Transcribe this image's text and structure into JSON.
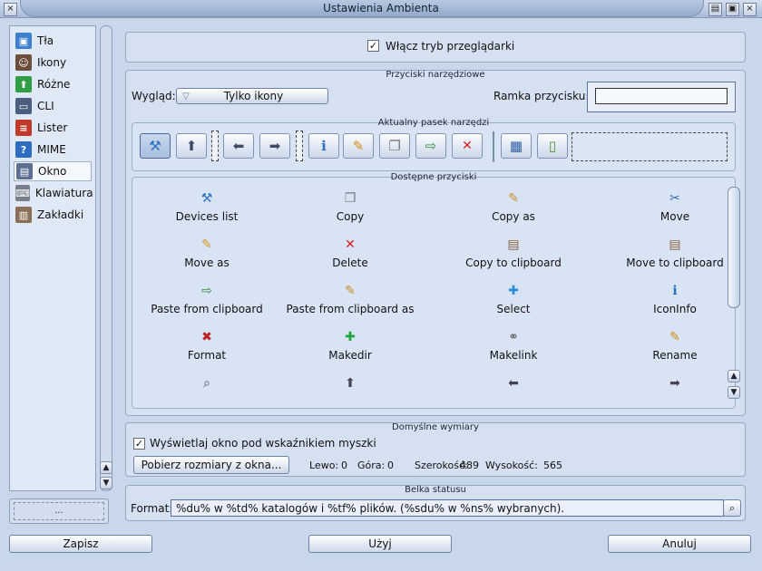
{
  "window": {
    "title": "Ustawienia Ambienta",
    "close_glyph": "×",
    "menu_glyphs": [
      "▤",
      "▣",
      "×"
    ]
  },
  "sidebar": {
    "items": [
      {
        "label": "Tła",
        "icon": "wallpaper-icon",
        "color": "#3d7fd0"
      },
      {
        "label": "Ikony",
        "icon": "user-icon",
        "color": "#6b4f3a"
      },
      {
        "label": "Różne",
        "icon": "green-arrow-icon",
        "color": "#2f9e44"
      },
      {
        "label": "CLI",
        "icon": "terminal-icon",
        "color": "#4a5f7f"
      },
      {
        "label": "Lister",
        "icon": "list-icon",
        "color": "#c0392b"
      },
      {
        "label": "MIME",
        "icon": "help-icon",
        "color": "#2d6cc0"
      },
      {
        "label": "Okno",
        "icon": "window-icon",
        "color": "#5c6f91"
      },
      {
        "label": "Klawiatura",
        "icon": "keyboard-icon",
        "color": "#777f8a"
      },
      {
        "label": "Zakładki",
        "icon": "bookmarks-icon",
        "color": "#8a6f56"
      }
    ],
    "selected_index": 6,
    "bottom_label": "..."
  },
  "top": {
    "browser_mode_label": "Włącz tryb przeglądarki",
    "browser_mode_checked": "✓"
  },
  "toolbar_buttons": {
    "title": "Przyciski narzędziowe",
    "look_label": "Wygląd:",
    "look_value": "Tylko ikony",
    "frame_label": "Ramka przycisku:"
  },
  "current_toolbar": {
    "title": "Aktualny pasek narzędzi"
  },
  "available_buttons": {
    "title": "Dostępne przyciski",
    "items": [
      {
        "label": "Devices list",
        "icon": "devices-icon",
        "glyph": "⚒",
        "color": "#2a6fc2"
      },
      {
        "label": "Copy",
        "icon": "copy-icon",
        "glyph": "❐",
        "color": "#777"
      },
      {
        "label": "Copy as",
        "icon": "copy-as-icon",
        "glyph": "✎",
        "color": "#c98a2a"
      },
      {
        "label": "Move",
        "icon": "move-icon",
        "glyph": "✂",
        "color": "#3a6fb7"
      },
      {
        "label": "Move as",
        "icon": "move-as-icon",
        "glyph": "✎",
        "color": "#d89a22"
      },
      {
        "label": "Delete",
        "icon": "delete-icon",
        "glyph": "✕",
        "color": "#d62020"
      },
      {
        "label": "Copy to clipboard",
        "icon": "copy-clipboard-icon",
        "glyph": "▤",
        "color": "#8a6442"
      },
      {
        "label": "Move to clipboard",
        "icon": "move-clipboard-icon",
        "glyph": "▤",
        "color": "#8a6442"
      },
      {
        "label": "Paste from clipboard",
        "icon": "paste-icon",
        "glyph": "⇨",
        "color": "#2f8f3a"
      },
      {
        "label": "Paste from clipboard as",
        "icon": "paste-as-icon",
        "glyph": "✎",
        "color": "#c98a2a"
      },
      {
        "label": "Select",
        "icon": "select-icon",
        "glyph": "✚",
        "color": "#2a8bd8"
      },
      {
        "label": "IconInfo",
        "icon": "info-icon",
        "glyph": "ℹ",
        "color": "#2d6cc0"
      },
      {
        "label": "Format",
        "icon": "format-icon",
        "glyph": "✖",
        "color": "#b22"
      },
      {
        "label": "Makedir",
        "icon": "makedir-icon",
        "glyph": "✚",
        "color": "#22a33a"
      },
      {
        "label": "Makelink",
        "icon": "makelink-icon",
        "glyph": "⚭",
        "color": "#666"
      },
      {
        "label": "Rename",
        "icon": "rename-icon",
        "glyph": "✎",
        "color": "#d88a12"
      },
      {
        "label": "",
        "icon": "search-icon",
        "glyph": "⌕",
        "color": "#445"
      },
      {
        "label": "",
        "icon": "up-arrow-icon",
        "glyph": "⬆",
        "color": "#445"
      },
      {
        "label": "",
        "icon": "left-arrow-icon",
        "glyph": "⬅",
        "color": "#445"
      },
      {
        "label": "",
        "icon": "right-arrow-icon",
        "glyph": "➡",
        "color": "#445"
      }
    ]
  },
  "default_size": {
    "title": "Domyślne wymiary",
    "show_under_mouse": "Wyświetlaj okno pod wskaźnikiem myszki",
    "show_under_mouse_checked": "✓",
    "get_size_button": "Pobierz rozmiary z okna...",
    "left_label": "Lewo:",
    "left_value": "0",
    "top_label": "Góra:",
    "top_value": "0",
    "width_label": "Szerokość:",
    "width_value": "489",
    "height_label": "Wysokość:",
    "height_value": "565"
  },
  "status_bar": {
    "title": "Belka statusu",
    "format_label": "Format:",
    "format_value": "%du% w %td% katalogów i %tf% plików. (%sdu% w %ns% wybranych)."
  },
  "footer": {
    "save": "Zapisz",
    "apply": "Użyj",
    "cancel": "Anuluj"
  }
}
